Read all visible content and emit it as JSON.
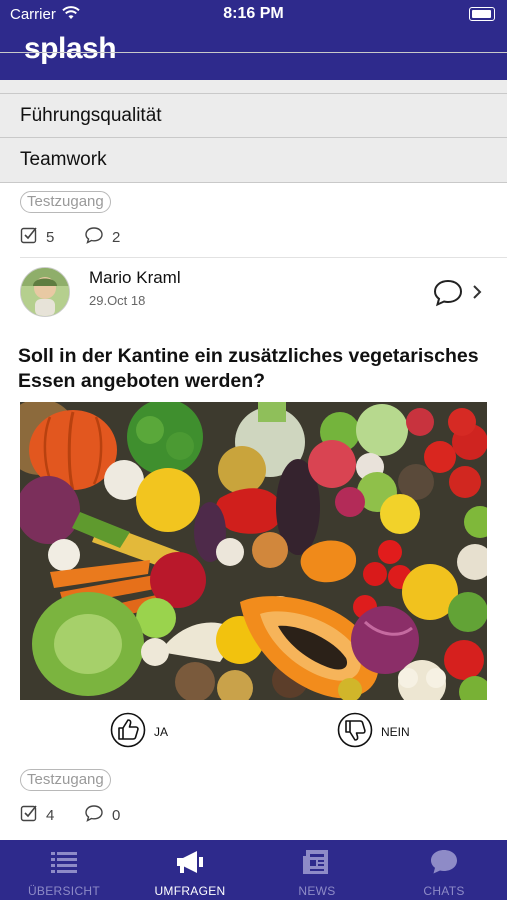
{
  "status_bar": {
    "carrier": "Carrier",
    "time": "8:16 PM"
  },
  "app": {
    "brand": "splash"
  },
  "poll_options": [
    "Führungsqualität",
    "Teamwork"
  ],
  "previous_post": {
    "tag": "Testzugang",
    "votes": "5",
    "comments": "2"
  },
  "post": {
    "author": "Mario Kraml",
    "date": "29.Oct 18",
    "question": "Soll in der Kantine ein zusätzliches vegetarisches Essen angeboten werden?",
    "vote_yes": "JA",
    "vote_no": "NEIN",
    "tag": "Testzugang",
    "votes": "4",
    "comments": "0"
  },
  "tabs": [
    {
      "label": "ÜBERSICHT",
      "icon": "list-icon",
      "active": false
    },
    {
      "label": "UMFRAGEN",
      "icon": "megaphone-icon",
      "active": true
    },
    {
      "label": "NEWS",
      "icon": "newspaper-icon",
      "active": false
    },
    {
      "label": "CHATS",
      "icon": "chat-bubble-icon",
      "active": false
    }
  ],
  "colors": {
    "brand": "#2e2a8c",
    "tab_inactive": "#8e8bc7",
    "tab_active": "#ffffff"
  }
}
